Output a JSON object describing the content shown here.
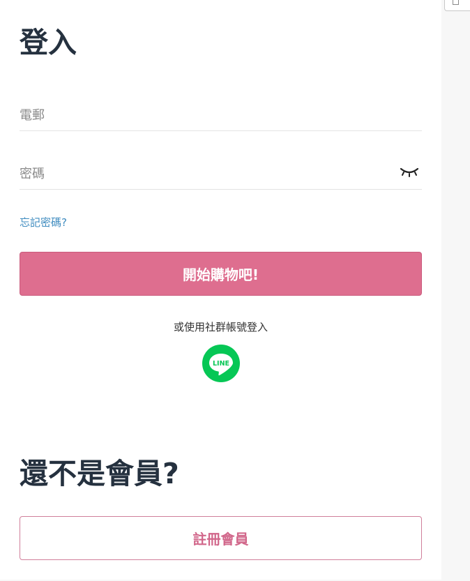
{
  "login": {
    "title": "登入",
    "email_placeholder": "電郵",
    "password_placeholder": "密碼",
    "forgot_password": "忘記密碼?",
    "submit_label": "開始購物吧!",
    "social_text": "或使用社群帳號登入",
    "line_label": "LINE"
  },
  "register": {
    "title": "還不是會員?",
    "button_label": "註冊會員"
  },
  "colors": {
    "primary": "#de6e8f",
    "secondary_text": "#d1668a",
    "link": "#3e8bbf",
    "heading": "#25313f",
    "line_green": "#06c755"
  }
}
